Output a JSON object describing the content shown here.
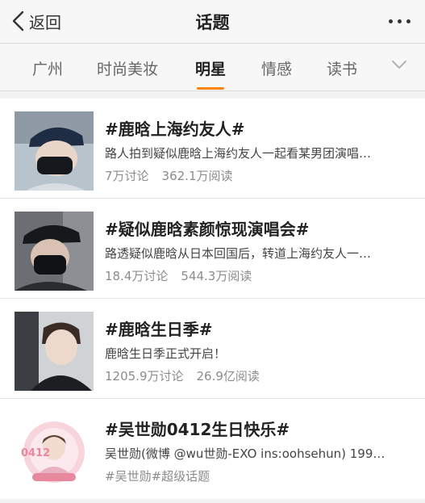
{
  "header": {
    "back_label": "返回",
    "title": "话题"
  },
  "tabs": [
    {
      "label": "广州",
      "active": false
    },
    {
      "label": "时尚美妆",
      "active": false
    },
    {
      "label": "明星",
      "active": true
    },
    {
      "label": "情感",
      "active": false
    },
    {
      "label": "读书",
      "active": false
    }
  ],
  "accent_color": "#ff8200",
  "topics": [
    {
      "title": "#鹿晗上海约友人#",
      "desc": "路人拍到疑似鹿晗上海约友人一起看某男团演唱…",
      "discuss": "7万讨论",
      "reads": "362.1万阅读"
    },
    {
      "title": "#疑似鹿晗素颜惊现演唱会#",
      "desc": "路透疑似鹿晗从日本回国后，转道上海约友人一…",
      "discuss": "18.4万讨论",
      "reads": "544.3万阅读"
    },
    {
      "title": "#鹿晗生日季#",
      "desc": "鹿晗生日季正式开启！",
      "discuss": "1205.9万讨论",
      "reads": "26.9亿阅读"
    },
    {
      "title": "#吴世勋0412生日快乐#",
      "desc": "吴世勋(微博 @wu世勋-EXO ins:oohsehun) 199…",
      "tags": "#吴世勋#超级话题",
      "badge": "0412"
    }
  ]
}
